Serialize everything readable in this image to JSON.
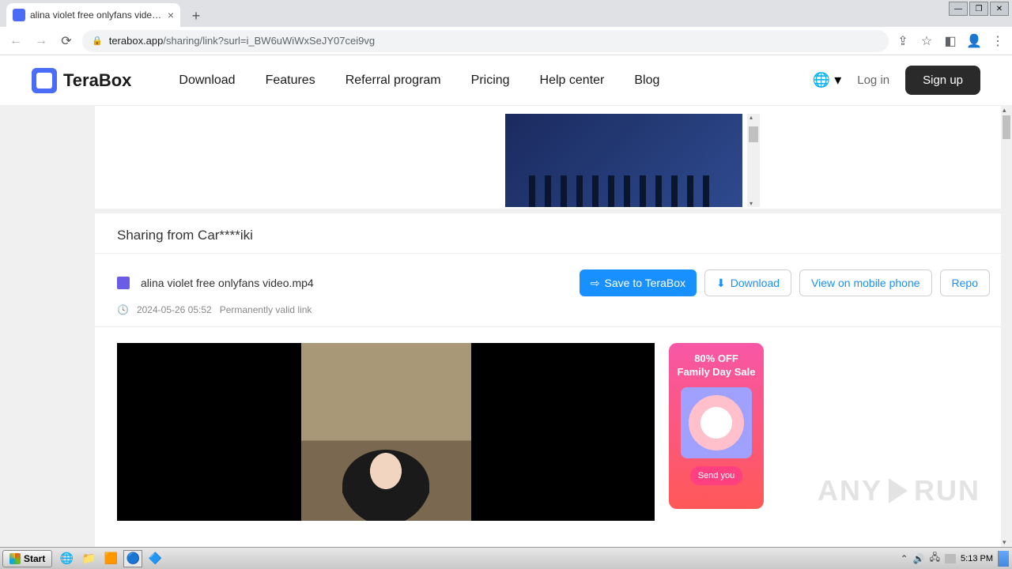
{
  "browser": {
    "tab_title": "alina violet free onlyfans video.mp4",
    "url_domain": "terabox.app",
    "url_path": "/sharing/link?surl=i_BW6uWiWxSeJY07cei9vg"
  },
  "header": {
    "brand": "TeraBox",
    "nav": [
      "Download",
      "Features",
      "Referral program",
      "Pricing",
      "Help center",
      "Blog"
    ],
    "login": "Log in",
    "signup": "Sign up"
  },
  "share": {
    "title": "Sharing from Car****iki",
    "file_name": "alina violet free onlyfans video.mp4",
    "timestamp": "2024-05-26 05:52",
    "validity": "Permanently valid link",
    "actions": {
      "save": "Save to TeraBox",
      "download": "Download",
      "view_mobile": "View on mobile phone",
      "report": "Repo"
    }
  },
  "promo": {
    "line1": "80% OFF",
    "line2": "Family Day Sale",
    "cta": "Send you"
  },
  "watermark": {
    "left": "ANY",
    "right": "RUN"
  },
  "taskbar": {
    "start": "Start",
    "time": "5:13 PM"
  }
}
